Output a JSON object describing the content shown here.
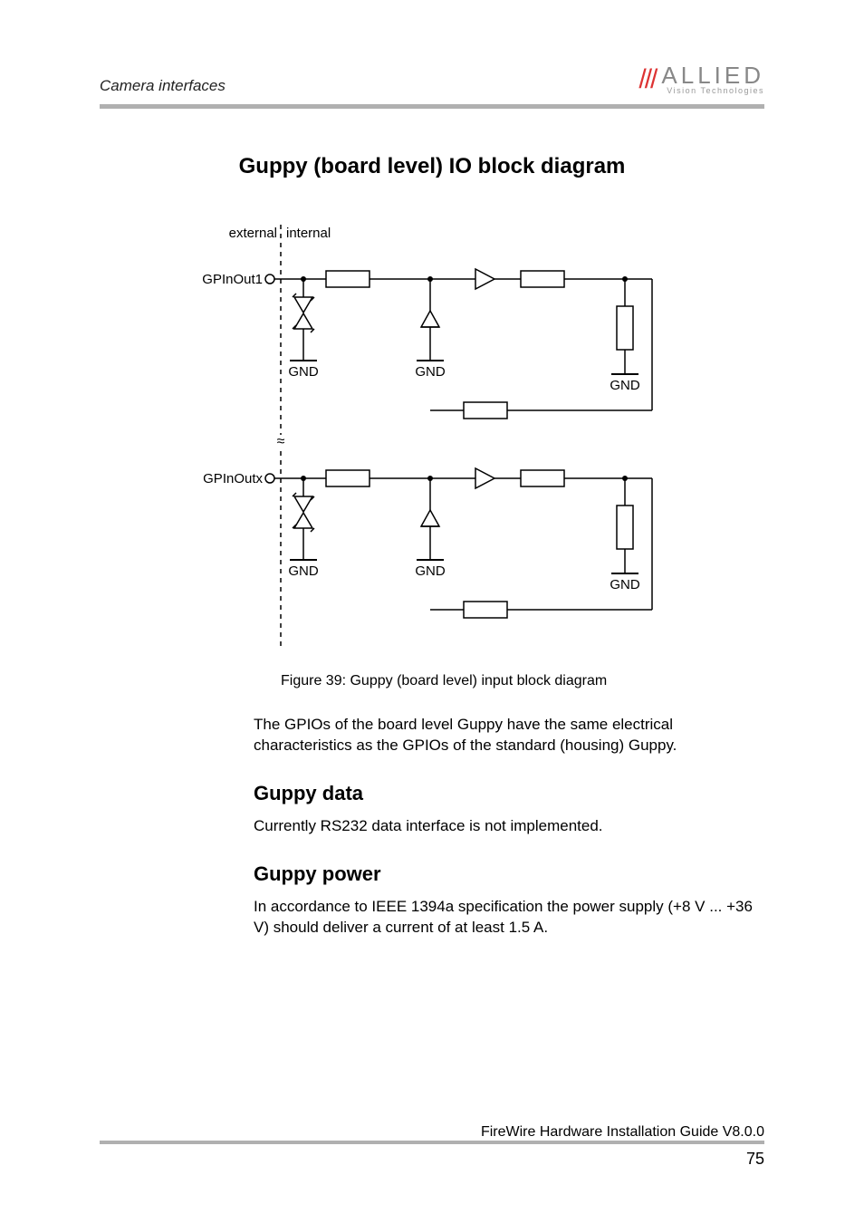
{
  "header": {
    "section": "Camera interfaces",
    "logo_main": "ALLIED",
    "logo_sub": "Vision Technologies"
  },
  "section_title": "Guppy (board level) IO block diagram",
  "diagram": {
    "label_external": "external",
    "label_internal": "internal",
    "port1": "GPInOut1",
    "portx": "GPInOutx",
    "gnd": "GND"
  },
  "figure_caption": "Figure 39: Guppy (board level) input block diagram",
  "paragraph_gpio": "The GPIOs of the board level Guppy have the same electrical characteristics as the GPIOs of the standard (housing) Guppy.",
  "sub_data_title": "Guppy data",
  "sub_data_text": "Currently RS232 data interface is not implemented.",
  "sub_power_title": "Guppy power",
  "sub_power_text": "In accordance to IEEE 1394a specification the power supply (+8 V ... +36 V) should deliver a current of at least 1.5 A.",
  "footer": {
    "guide": "FireWire Hardware Installation Guide V8.0.0",
    "page": "75"
  }
}
